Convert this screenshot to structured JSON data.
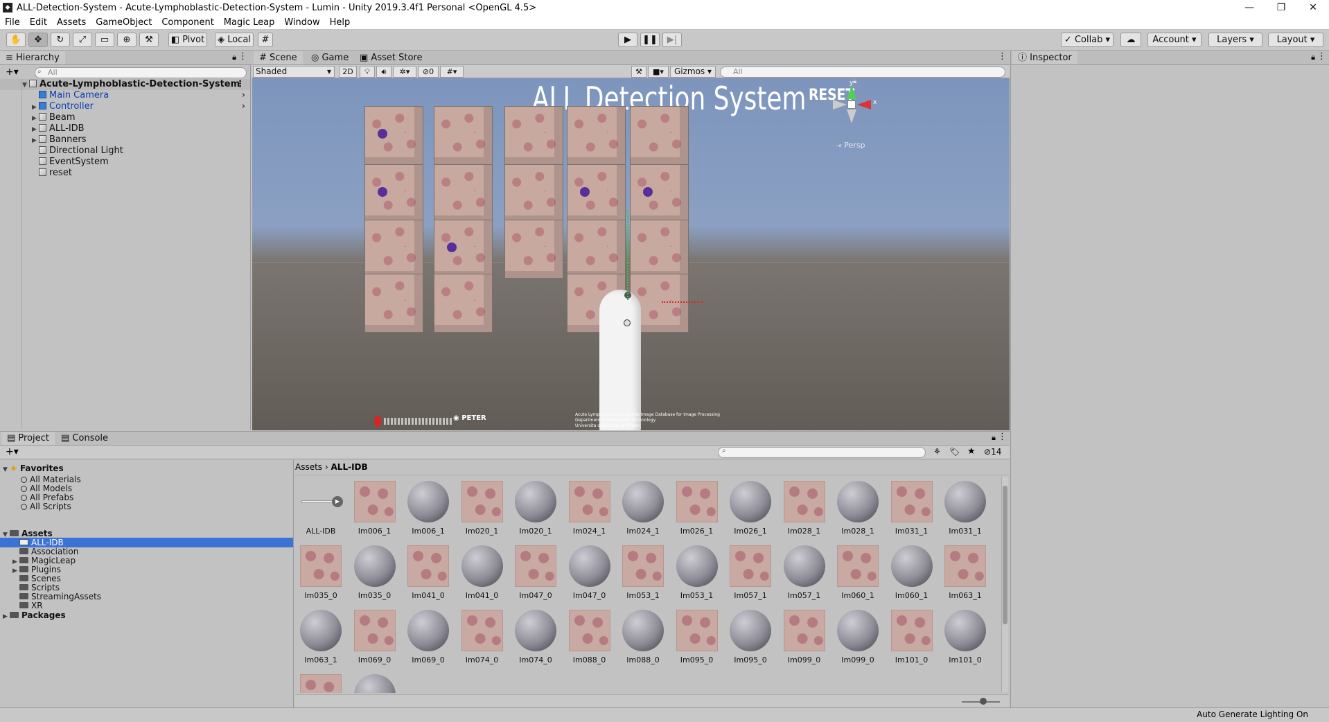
{
  "window": {
    "title": "ALL-Detection-System - Acute-Lymphoblastic-Detection-System - Lumin - Unity 2019.3.4f1 Personal <OpenGL 4.5>"
  },
  "menu": [
    "File",
    "Edit",
    "Assets",
    "GameObject",
    "Component",
    "Magic Leap",
    "Window",
    "Help"
  ],
  "toolbar": {
    "pivot": "Pivot",
    "local": "Local",
    "collab": "Collab",
    "account": "Account",
    "layers": "Layers",
    "layout": "Layout"
  },
  "hierarchy": {
    "tab": "Hierarchy",
    "search_placeholder": "All",
    "scene_name": "Acute-Lymphoblastic-Detection-System",
    "items": [
      {
        "label": "Main Camera",
        "expandable": false
      },
      {
        "label": "Controller",
        "expandable": true
      },
      {
        "label": "Beam",
        "expandable": true
      },
      {
        "label": "ALL-IDB",
        "expandable": true
      },
      {
        "label": "Banners",
        "expandable": true
      },
      {
        "label": "Directional Light",
        "expandable": false
      },
      {
        "label": "EventSystem",
        "expandable": false
      },
      {
        "label": "reset",
        "expandable": false
      }
    ]
  },
  "scene": {
    "tabs": [
      "Scene",
      "Game",
      "Asset Store"
    ],
    "shading": "Shaded",
    "mode_2d": "2D",
    "hidden_count": "0",
    "gizmos": "Gizmos",
    "search_placeholder": "All",
    "banner_title": "ALL Detection System",
    "reset_label": "RESET",
    "persp_label": "Persp",
    "footer_text": "Acute Lymphoblastic Leukemia Image Database for Image Processing\nDepartment of Information Technology\nUniversita degli Studi di Milano"
  },
  "inspector": {
    "tab": "Inspector"
  },
  "project": {
    "tabs": [
      "Project",
      "Console"
    ],
    "hidden_count": "14",
    "favorites_label": "Favorites",
    "favorites": [
      "All Materials",
      "All Models",
      "All Prefabs",
      "All Scripts"
    ],
    "assets_label": "Assets",
    "folders": [
      {
        "label": "ALL-IDB",
        "expandable": false,
        "selected": true
      },
      {
        "label": "Association",
        "expandable": false,
        "selected": false
      },
      {
        "label": "MagicLeap",
        "expandable": true,
        "selected": false
      },
      {
        "label": "Plugins",
        "expandable": true,
        "selected": false
      },
      {
        "label": "Scenes",
        "expandable": false,
        "selected": false
      },
      {
        "label": "Scripts",
        "expandable": false,
        "selected": false
      },
      {
        "label": "StreamingAssets",
        "expandable": false,
        "selected": false
      },
      {
        "label": "XR",
        "expandable": false,
        "selected": false
      }
    ],
    "packages_label": "Packages",
    "breadcrumb": [
      "Assets",
      "ALL-IDB"
    ],
    "assets": [
      {
        "name": "ALL-IDB",
        "kind": "anim"
      },
      {
        "name": "Im006_1",
        "kind": "tex"
      },
      {
        "name": "Im006_1",
        "kind": "mat"
      },
      {
        "name": "Im020_1",
        "kind": "tex"
      },
      {
        "name": "Im020_1",
        "kind": "mat"
      },
      {
        "name": "Im024_1",
        "kind": "tex"
      },
      {
        "name": "Im024_1",
        "kind": "mat"
      },
      {
        "name": "Im026_1",
        "kind": "tex"
      },
      {
        "name": "Im026_1",
        "kind": "mat"
      },
      {
        "name": "Im028_1",
        "kind": "tex"
      },
      {
        "name": "Im028_1",
        "kind": "mat"
      },
      {
        "name": "Im031_1",
        "kind": "tex"
      },
      {
        "name": "Im031_1",
        "kind": "mat"
      },
      {
        "name": "Im035_0",
        "kind": "tex"
      },
      {
        "name": "Im035_0",
        "kind": "mat"
      },
      {
        "name": "Im041_0",
        "kind": "tex"
      },
      {
        "name": "Im041_0",
        "kind": "mat"
      },
      {
        "name": "Im047_0",
        "kind": "tex"
      },
      {
        "name": "Im047_0",
        "kind": "mat"
      },
      {
        "name": "Im053_1",
        "kind": "tex"
      },
      {
        "name": "Im053_1",
        "kind": "mat"
      },
      {
        "name": "Im057_1",
        "kind": "tex"
      },
      {
        "name": "Im057_1",
        "kind": "mat"
      },
      {
        "name": "Im060_1",
        "kind": "tex"
      },
      {
        "name": "Im060_1",
        "kind": "mat"
      },
      {
        "name": "Im063_1",
        "kind": "tex"
      },
      {
        "name": "Im063_1",
        "kind": "mat"
      },
      {
        "name": "Im069_0",
        "kind": "tex"
      },
      {
        "name": "Im069_0",
        "kind": "mat"
      },
      {
        "name": "Im074_0",
        "kind": "tex"
      },
      {
        "name": "Im074_0",
        "kind": "mat"
      },
      {
        "name": "Im088_0",
        "kind": "tex"
      },
      {
        "name": "Im088_0",
        "kind": "mat"
      },
      {
        "name": "Im095_0",
        "kind": "tex"
      },
      {
        "name": "Im095_0",
        "kind": "mat"
      },
      {
        "name": "Im099_0",
        "kind": "tex"
      },
      {
        "name": "Im099_0",
        "kind": "mat"
      },
      {
        "name": "Im101_0",
        "kind": "tex"
      },
      {
        "name": "Im101_0",
        "kind": "mat"
      },
      {
        "name": "",
        "kind": "tex"
      },
      {
        "name": "",
        "kind": "mat"
      }
    ]
  },
  "status": {
    "right_text": "Auto Generate Lighting On"
  }
}
